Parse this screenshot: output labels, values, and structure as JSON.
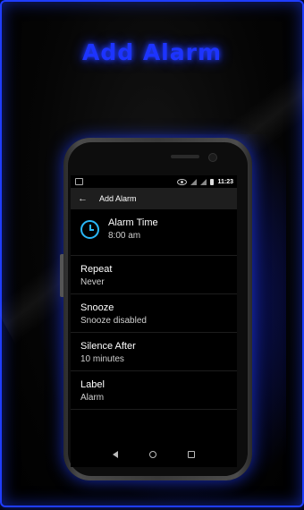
{
  "promo": {
    "title": "Add Alarm"
  },
  "status_bar": {
    "time": "11:23"
  },
  "app_bar": {
    "title": "Add Alarm",
    "back_icon": "arrow-back-icon"
  },
  "settings": [
    {
      "title": "Alarm Time",
      "value": "8:00 am",
      "icon": "clock-icon",
      "icon_color": "#29b6f6"
    },
    {
      "title": "Repeat",
      "value": "Never"
    },
    {
      "title": "Snooze",
      "value": "Snooze disabled"
    },
    {
      "title": "Silence After",
      "value": "10 minutes"
    },
    {
      "title": "Label",
      "value": "Alarm"
    }
  ],
  "colors": {
    "accent": "#1d34ff",
    "clock_icon": "#29b6f6"
  }
}
